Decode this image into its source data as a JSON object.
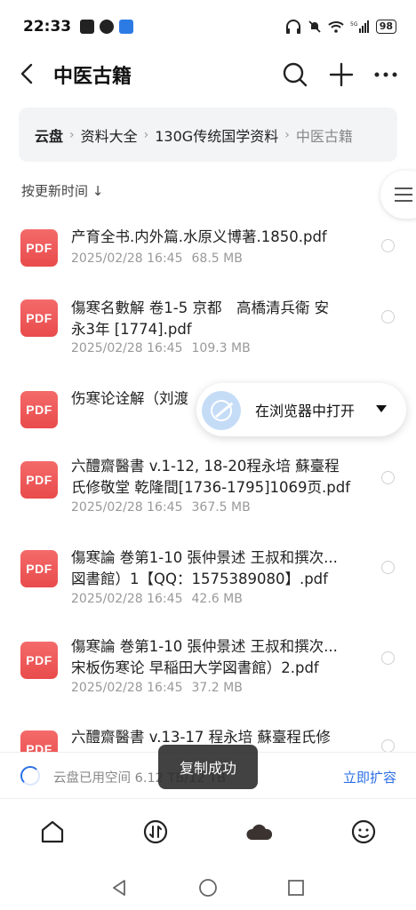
{
  "status_bar": {
    "time": "22:33",
    "battery": "98",
    "network": "5G"
  },
  "header": {
    "title": "中医古籍"
  },
  "breadcrumb": {
    "root": "云盘",
    "items": [
      "资料大全",
      "130G传统国学资料"
    ],
    "current": "中医古籍"
  },
  "sort": {
    "label": "按更新时间 ↓"
  },
  "files": [
    {
      "name_line1": "产育全书.内外篇.水原义博著.1850.pdf",
      "name_line2": "",
      "date": "2025/02/28 16:45",
      "size": "68.5 MB"
    },
    {
      "name_line1": "傷寒名數解 卷1-5 京都　高橋清兵衛 安",
      "name_line2": "永3年 [1774].pdf",
      "date": "2025/02/28 16:45",
      "size": "109.3 MB"
    },
    {
      "name_line1": "伤寒论诠解（刘渡",
      "name_line2": "",
      "date": "",
      "size": ""
    },
    {
      "name_line1": "六醴齋醫書 v.1-12, 18-20程永培 蘇臺程",
      "name_line2": "氏修敬堂 乾隆間[1736-1795]1069页.pdf",
      "date": "2025/02/28 16:45",
      "size": "367.5 MB"
    },
    {
      "name_line1": "傷寒論 巻第1-10 張仲景述 王叔和撰次...",
      "name_line2": "図書館）1【QQ：1575389080】.pdf",
      "date": "2025/02/28 16:45",
      "size": "42.6 MB"
    },
    {
      "name_line1": "傷寒論 巻第1-10 張仲景述 王叔和撰次...",
      "name_line2": "宋板伤寒论 早稲田大学図書館）2.pdf",
      "date": "2025/02/28 16:45",
      "size": "37.2 MB"
    },
    {
      "name_line1": "六醴齋醫書 v.13-17 程永培 蘇臺程氏修",
      "name_line2": "",
      "date": "",
      "size": ""
    }
  ],
  "pdf_badge": "PDF",
  "browser_popup": {
    "label": "在浏览器中打开"
  },
  "storage": {
    "text": "云盘已用空间 6.12 TB/12 TB",
    "action": "立即扩容"
  },
  "toast": {
    "text": "复制成功"
  },
  "nav": {
    "items": [
      "home-icon",
      "transfer-icon",
      "cloud-icon",
      "profile-icon"
    ]
  },
  "colors": {
    "accent": "#2b6fe6",
    "pdf_red": "#ef5a5a",
    "breadcrumb_bg": "#f2f4f6"
  }
}
